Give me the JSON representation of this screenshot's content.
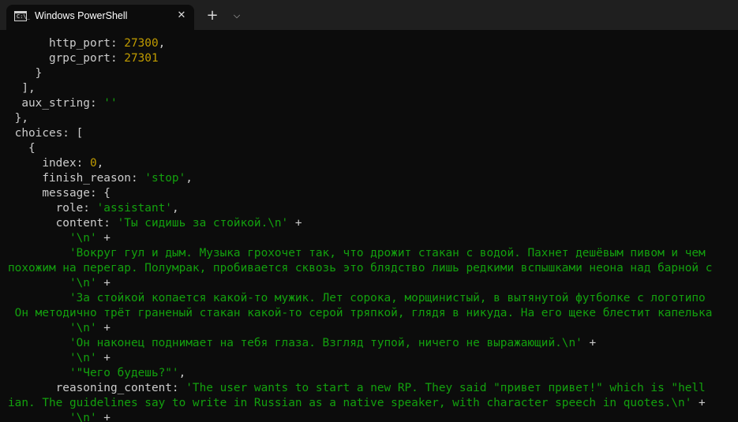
{
  "window": {
    "tab_title": "Windows PowerShell",
    "tab_icon": "powershell-console-icon",
    "tab_icon_glyph": "C:\\_",
    "close_glyph": "✕",
    "new_tab_glyph": "+",
    "dropdown_glyph": "⌵"
  },
  "colors": {
    "background": "#0c0c0c",
    "titlebar": "#1f1f1f",
    "default_text": "#cccccc",
    "number": "#c19c00",
    "string": "#13a10e"
  },
  "terminal": {
    "lines": [
      [
        {
          "c": "def",
          "t": "      http_port: "
        },
        {
          "c": "num",
          "t": "27300"
        },
        {
          "c": "def",
          "t": ","
        }
      ],
      [
        {
          "c": "def",
          "t": "      grpc_port: "
        },
        {
          "c": "num",
          "t": "27301"
        }
      ],
      [
        {
          "c": "def",
          "t": "    }"
        }
      ],
      [
        {
          "c": "def",
          "t": "  ],"
        }
      ],
      [
        {
          "c": "def",
          "t": "  aux_string: "
        },
        {
          "c": "str",
          "t": "''"
        }
      ],
      [
        {
          "c": "def",
          "t": " },"
        }
      ],
      [
        {
          "c": "def",
          "t": " choices: ["
        }
      ],
      [
        {
          "c": "def",
          "t": "   {"
        }
      ],
      [
        {
          "c": "def",
          "t": "     index: "
        },
        {
          "c": "num",
          "t": "0"
        },
        {
          "c": "def",
          "t": ","
        }
      ],
      [
        {
          "c": "def",
          "t": "     finish_reason: "
        },
        {
          "c": "str",
          "t": "'stop'"
        },
        {
          "c": "def",
          "t": ","
        }
      ],
      [
        {
          "c": "def",
          "t": "     message: {"
        }
      ],
      [
        {
          "c": "def",
          "t": "       role: "
        },
        {
          "c": "str",
          "t": "'assistant'"
        },
        {
          "c": "def",
          "t": ","
        }
      ],
      [
        {
          "c": "def",
          "t": "       content: "
        },
        {
          "c": "str",
          "t": "'Ты сидишь за стойкой.\\n'"
        },
        {
          "c": "def",
          "t": " +"
        }
      ],
      [
        {
          "c": "str",
          "t": "         '\\n'"
        },
        {
          "c": "def",
          "t": " +"
        }
      ],
      [
        {
          "c": "str",
          "t": "         'Вокруг гул и дым. Музыка грохочет так, что дрожит стакан с водой. Пахнет дешёвым пивом и чем"
        }
      ],
      [
        {
          "c": "str",
          "t": "похожим на перегар. Полумрак, пробивается сквозь это блядство лишь редкими вспышками неона над барной с"
        }
      ],
      [
        {
          "c": "str",
          "t": "         '\\n'"
        },
        {
          "c": "def",
          "t": " +"
        }
      ],
      [
        {
          "c": "str",
          "t": "         'За стойкой копается какой-то мужик. Лет сорока, морщинистый, в вытянутой футболке с логотипо"
        }
      ],
      [
        {
          "c": "str",
          "t": " Он методично трёт граненый стакан какой-то серой тряпкой, глядя в никуда. На его щеке блестит капелька"
        }
      ],
      [
        {
          "c": "str",
          "t": "         '\\n'"
        },
        {
          "c": "def",
          "t": " +"
        }
      ],
      [
        {
          "c": "str",
          "t": "         'Он наконец поднимает на тебя глаза. Взгляд тупой, ничего не выражающий.\\n'"
        },
        {
          "c": "def",
          "t": " +"
        }
      ],
      [
        {
          "c": "str",
          "t": "         '\\n'"
        },
        {
          "c": "def",
          "t": " +"
        }
      ],
      [
        {
          "c": "str",
          "t": "         '\"Чего будешь?\"'"
        },
        {
          "c": "def",
          "t": ","
        }
      ],
      [
        {
          "c": "def",
          "t": "       reasoning_content: "
        },
        {
          "c": "str",
          "t": "'The user wants to start a new RP. They said \"привет привет!\" which is \"hell"
        }
      ],
      [
        {
          "c": "str",
          "t": "ian. The guidelines say to write in Russian as a native speaker, with character speech in quotes.\\n'"
        },
        {
          "c": "def",
          "t": " +"
        }
      ],
      [
        {
          "c": "str",
          "t": "         '\\n'"
        },
        {
          "c": "def",
          "t": " +"
        }
      ]
    ]
  }
}
